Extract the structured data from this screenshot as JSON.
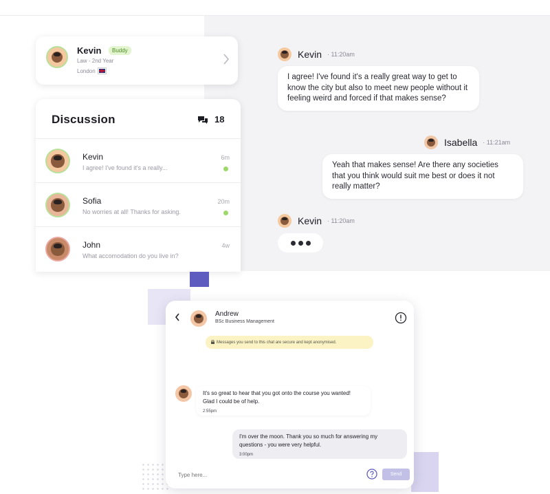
{
  "profile": {
    "name": "Kevin",
    "badge": "Buddy",
    "subtitle": "Law - 2nd Year",
    "location": "London"
  },
  "discussion": {
    "title": "Discussion",
    "count": "18",
    "conversations": [
      {
        "name": "Kevin",
        "preview": "I agree! I've found it's a really...",
        "time": "6m"
      },
      {
        "name": "Sofia",
        "preview": "No worries at all! Thanks for asking.",
        "time": "20m"
      },
      {
        "name": "John",
        "preview": "What accomodation do you live in?",
        "time": "4w"
      }
    ]
  },
  "chat": {
    "messages": [
      {
        "sender": "Kevin",
        "time": "11:20am",
        "text": "I agree! I've found it's a really great way to get to know the city but also to meet new people without it feeling weird and forced if that makes sense?"
      },
      {
        "sender": "Isabella",
        "time": "11:21am",
        "text": "Yeah that makes sense! Are there any societies that you think would suit me best or does it not really matter?"
      },
      {
        "sender": "Kevin",
        "time": "11:20am"
      }
    ]
  },
  "phone": {
    "contact_name": "Andrew",
    "contact_course": "BSc Business Management",
    "secure_notice": "Messages you send to this chat are secure and kept anonymised.",
    "incoming": {
      "text": "It's so great to hear that you got onto the course you wanted! Glad I could be of help.",
      "time": "2:55pm"
    },
    "outgoing": {
      "text": "I'm over the moon. Thank you so much for answering my questions - you were very helpful.",
      "time": "3:00pm"
    },
    "input_placeholder": "Type here...",
    "send_label": "Send"
  },
  "colors": {
    "accent": "#5f5cc0",
    "online": "#9fd86a",
    "badge_bg": "#e3f5cf",
    "notice_bg": "#fbf3c4"
  }
}
